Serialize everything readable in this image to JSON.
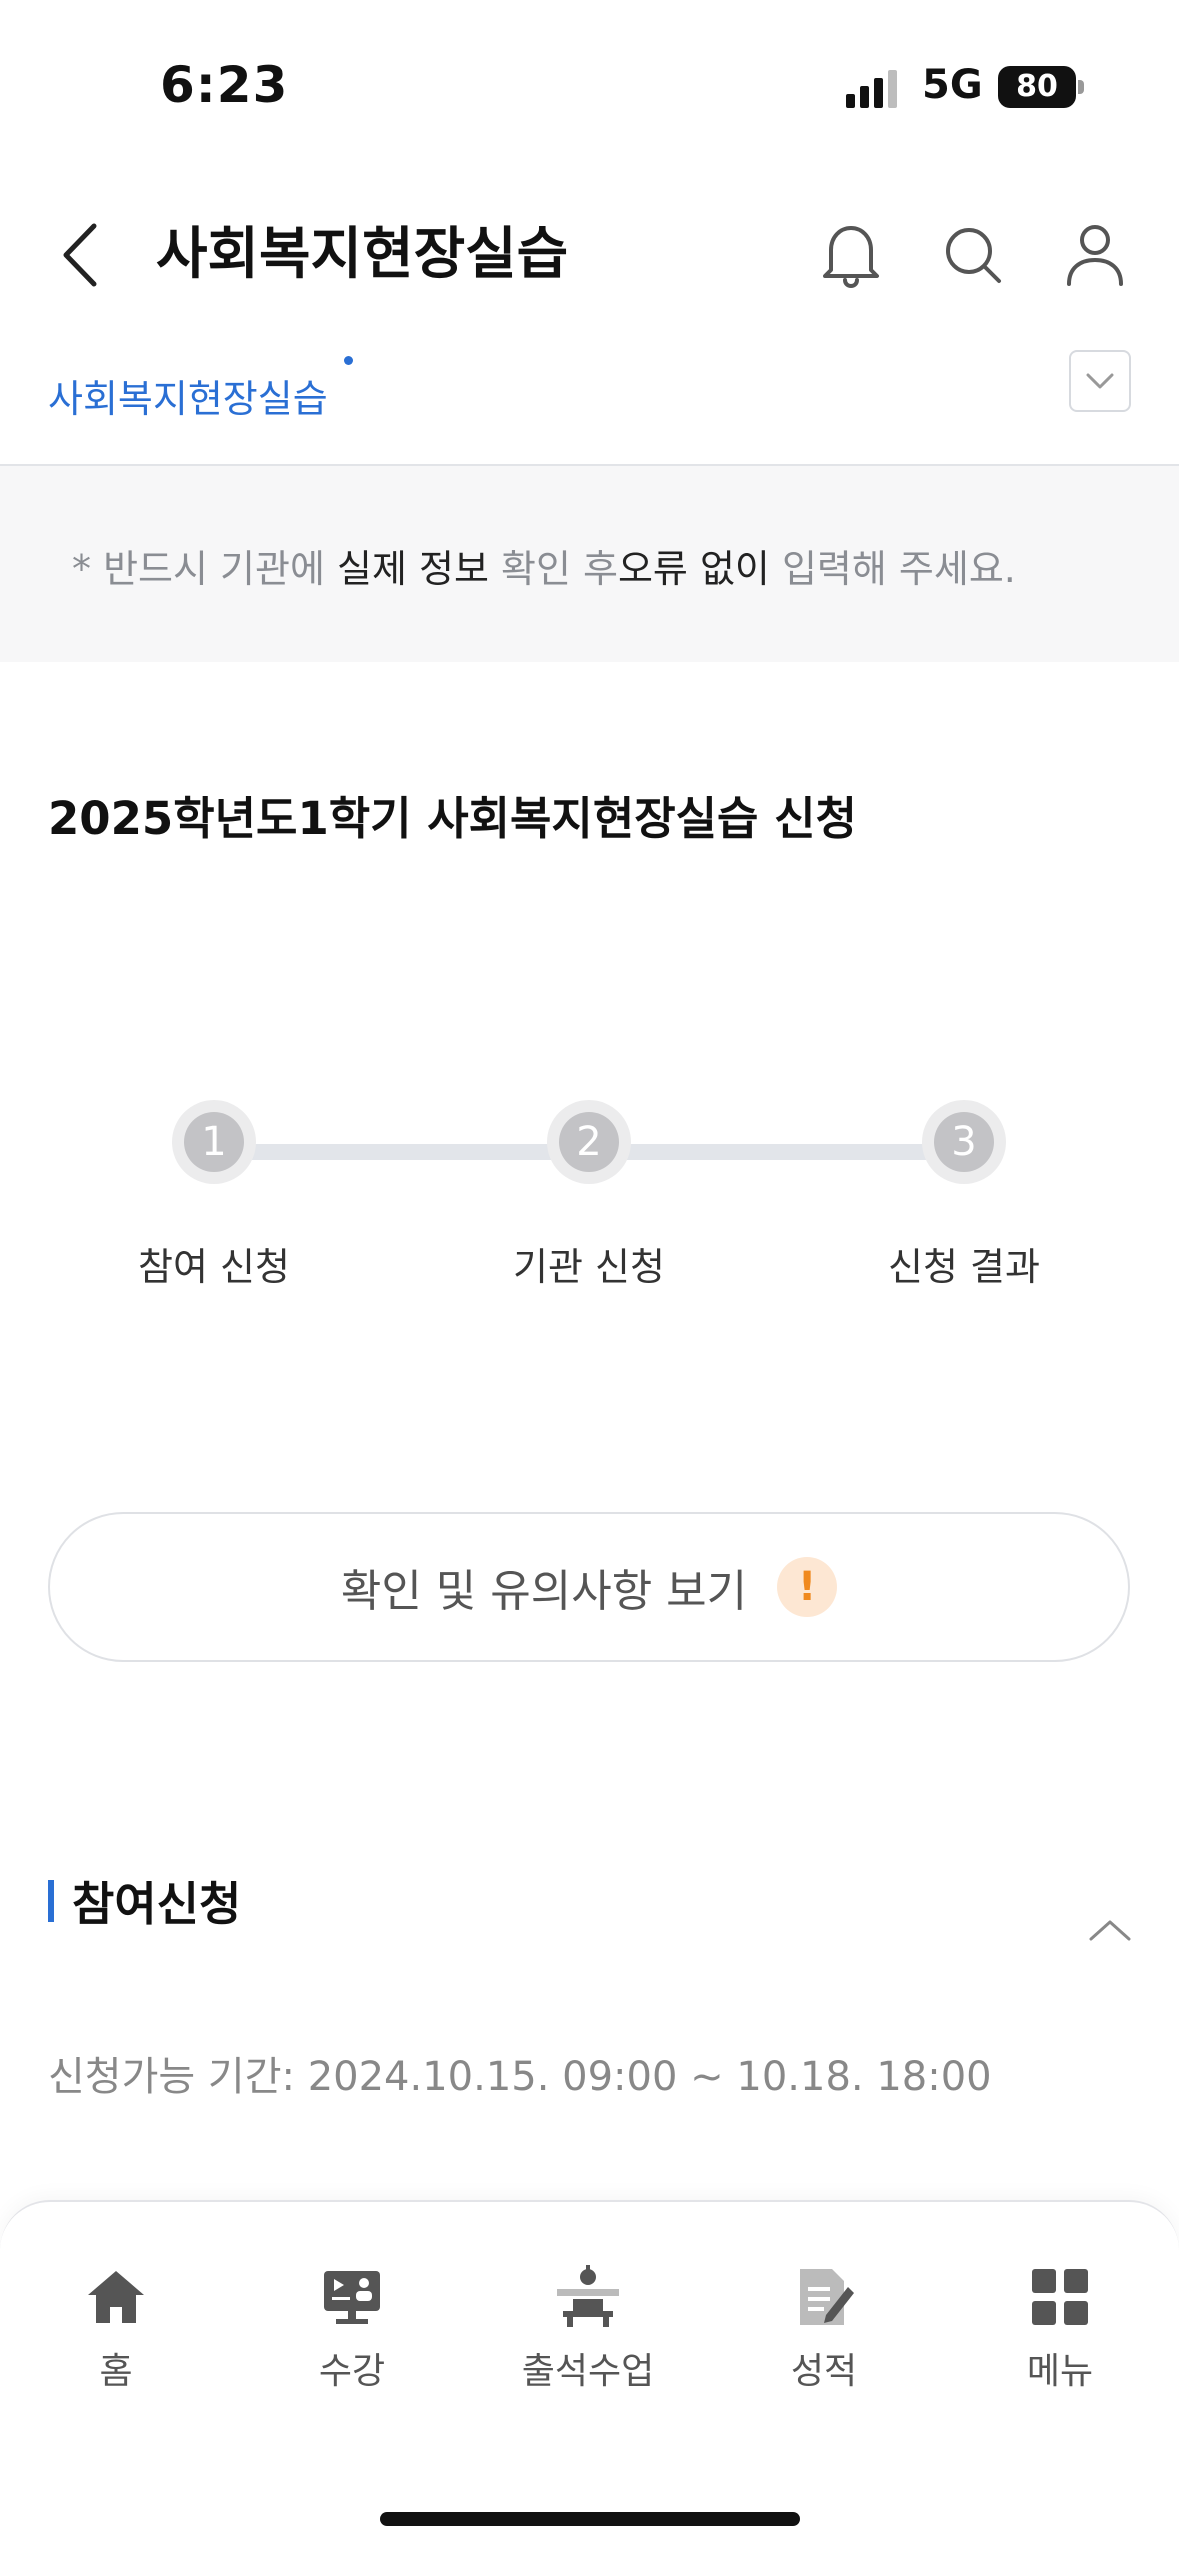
{
  "status_bar": {
    "time": "6:23",
    "network": "5G",
    "battery": "80"
  },
  "header": {
    "title": "사회복지현장실습"
  },
  "subtab": {
    "label": "사회복지현장실습"
  },
  "notice": {
    "parts": [
      "* 반드시 기관에 ",
      "실제 정보",
      " 확인 후",
      "오류 없이",
      " 입력해 주세요."
    ]
  },
  "apply_title": "2025학년도1학기 사회복지현장실습 신청",
  "stepper": {
    "steps": [
      {
        "num": "1",
        "label": "참여 신청"
      },
      {
        "num": "2",
        "label": "기관 신청"
      },
      {
        "num": "3",
        "label": "신청 결과"
      }
    ]
  },
  "info_button": {
    "label": "확인 및 유의사항 보기",
    "icon": "!"
  },
  "participation": {
    "title": "참여신청",
    "period": "신청가능 기간: 2024.10.15. 09:00 ~ 10.18. 18:00"
  },
  "bottom_nav": {
    "items": [
      {
        "label": "홈",
        "icon": "home-icon"
      },
      {
        "label": "수강",
        "icon": "lecture-icon"
      },
      {
        "label": "출석수업",
        "icon": "attendance-class-icon"
      },
      {
        "label": "성적",
        "icon": "grade-icon"
      },
      {
        "label": "메뉴",
        "icon": "menu-grid-icon"
      }
    ]
  },
  "colors": {
    "accent": "#2a6fd4",
    "warning": "#f08a1f"
  }
}
